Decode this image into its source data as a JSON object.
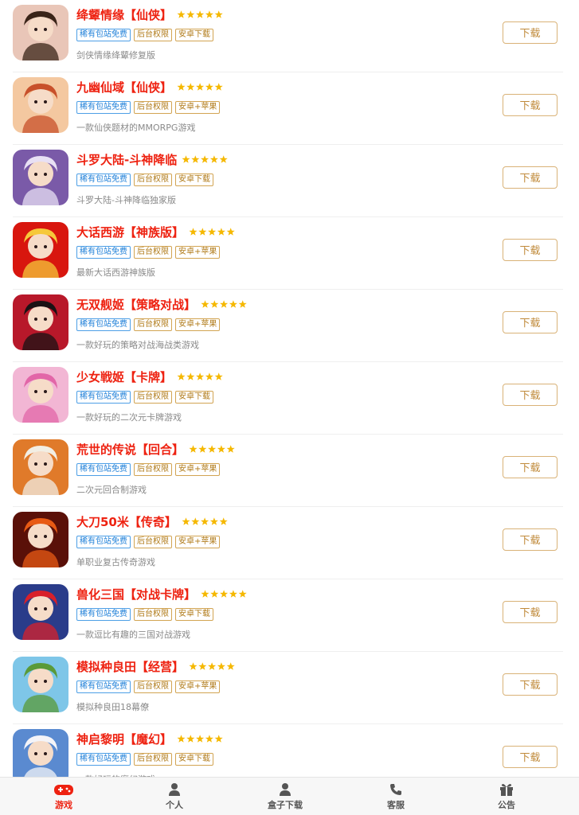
{
  "games": [
    {
      "title": "绛颦情缘【仙侠】",
      "tags": [
        "稀有包站免费",
        "后台权限",
        "安卓下载"
      ],
      "desc": "剑侠情缘绛颦修复版",
      "download": "下载",
      "icon": {
        "name": "fairy-girl-icon",
        "bg": "#e9c6b8",
        "accent": "#3a2418"
      }
    },
    {
      "title": "九幽仙域【仙侠】",
      "tags": [
        "稀有包站免费",
        "后台权限",
        "安卓+苹果"
      ],
      "desc": "一款仙侠题材的MMORPG游戏",
      "download": "下载",
      "icon": {
        "name": "red-hair-fairy-icon",
        "bg": "#f4c8a0",
        "accent": "#c8502a"
      }
    },
    {
      "title": "斗罗大陆-斗神降临",
      "tags": [
        "稀有包站免费",
        "后台权限",
        "安卓下载"
      ],
      "desc": "斗罗大陆-斗神降临独家版",
      "download": "下载",
      "icon": {
        "name": "douluo-girl-icon",
        "bg": "#7a5aa8",
        "accent": "#e8e0f4"
      }
    },
    {
      "title": "大话西游【神族版】",
      "tags": [
        "稀有包站免费",
        "后台权限",
        "安卓+苹果"
      ],
      "desc": "最新大话西游神族版",
      "download": "下载",
      "icon": {
        "name": "xiyou-emblem-icon",
        "bg": "#d8160e",
        "accent": "#f6c83a"
      }
    },
    {
      "title": "无双舰姬【策略对战】",
      "tags": [
        "稀有包站免费",
        "后台权限",
        "安卓+苹果"
      ],
      "desc": "一款好玩的策略对战海战类游戏",
      "download": "下载",
      "icon": {
        "name": "anime-girl-icon",
        "bg": "#b8182a",
        "accent": "#1a1214"
      }
    },
    {
      "title": "少女戦姬【卡牌】",
      "tags": [
        "稀有包站免费",
        "后台权限",
        "安卓下载"
      ],
      "desc": "一款好玩的二次元卡牌游戏",
      "download": "下载",
      "icon": {
        "name": "pink-hair-girl-icon",
        "bg": "#f2b6d4",
        "accent": "#e266a8"
      }
    },
    {
      "title": "荒世的传说【回合】",
      "tags": [
        "稀有包站免费",
        "后台权限",
        "安卓+苹果"
      ],
      "desc": "二次元回合制游戏",
      "download": "下载",
      "icon": {
        "name": "white-hair-hero-icon",
        "bg": "#e07a2a",
        "accent": "#f2eee4"
      }
    },
    {
      "title": "大刀50米【传奇】",
      "tags": [
        "稀有包站免费",
        "后台权限",
        "安卓+苹果"
      ],
      "desc": "单职业复古传奇游戏",
      "download": "下载",
      "icon": {
        "name": "dragon-warrior-icon",
        "bg": "#5a1008",
        "accent": "#e85a14"
      }
    },
    {
      "title": "兽化三国【对战卡牌】",
      "tags": [
        "稀有包站免费",
        "后台权限",
        "安卓下载"
      ],
      "desc": "一款逗比有趣的三国对战游戏",
      "download": "下载",
      "icon": {
        "name": "masked-warrior-icon",
        "bg": "#2a3c8a",
        "accent": "#d8202a"
      }
    },
    {
      "title": "模拟种良田【经营】",
      "tags": [
        "稀有包站免费",
        "后台权限",
        "安卓+苹果"
      ],
      "desc": "模拟种良田18幕僚",
      "download": "下载",
      "icon": {
        "name": "farmer-field-icon",
        "bg": "#7ec6e8",
        "accent": "#5a9a38"
      }
    },
    {
      "title": "神启黎明【魔幻】",
      "tags": [
        "稀有包站免费",
        "后台权限",
        "安卓下载"
      ],
      "desc": "一款好玩的魔幻游戏",
      "download": "下载",
      "icon": {
        "name": "white-hair-mage-icon",
        "bg": "#5a8ad0",
        "accent": "#f4f4f8"
      }
    }
  ],
  "tabbar": [
    {
      "label": "游戏",
      "icon": "gamepad-icon",
      "active": true
    },
    {
      "label": "个人",
      "icon": "user-icon",
      "active": false
    },
    {
      "label": "盒子下载",
      "icon": "user-download-icon",
      "active": false
    },
    {
      "label": "客服",
      "icon": "phone-icon",
      "active": false
    },
    {
      "label": "公告",
      "icon": "gift-icon",
      "active": false
    }
  ],
  "colors": {
    "title": "#ee2211",
    "tag_blue": "#1e7fd8",
    "tag_gold": "#b07a18",
    "button": "#c08a3a",
    "star": "#f5b800",
    "active_tab": "#ee2211"
  }
}
